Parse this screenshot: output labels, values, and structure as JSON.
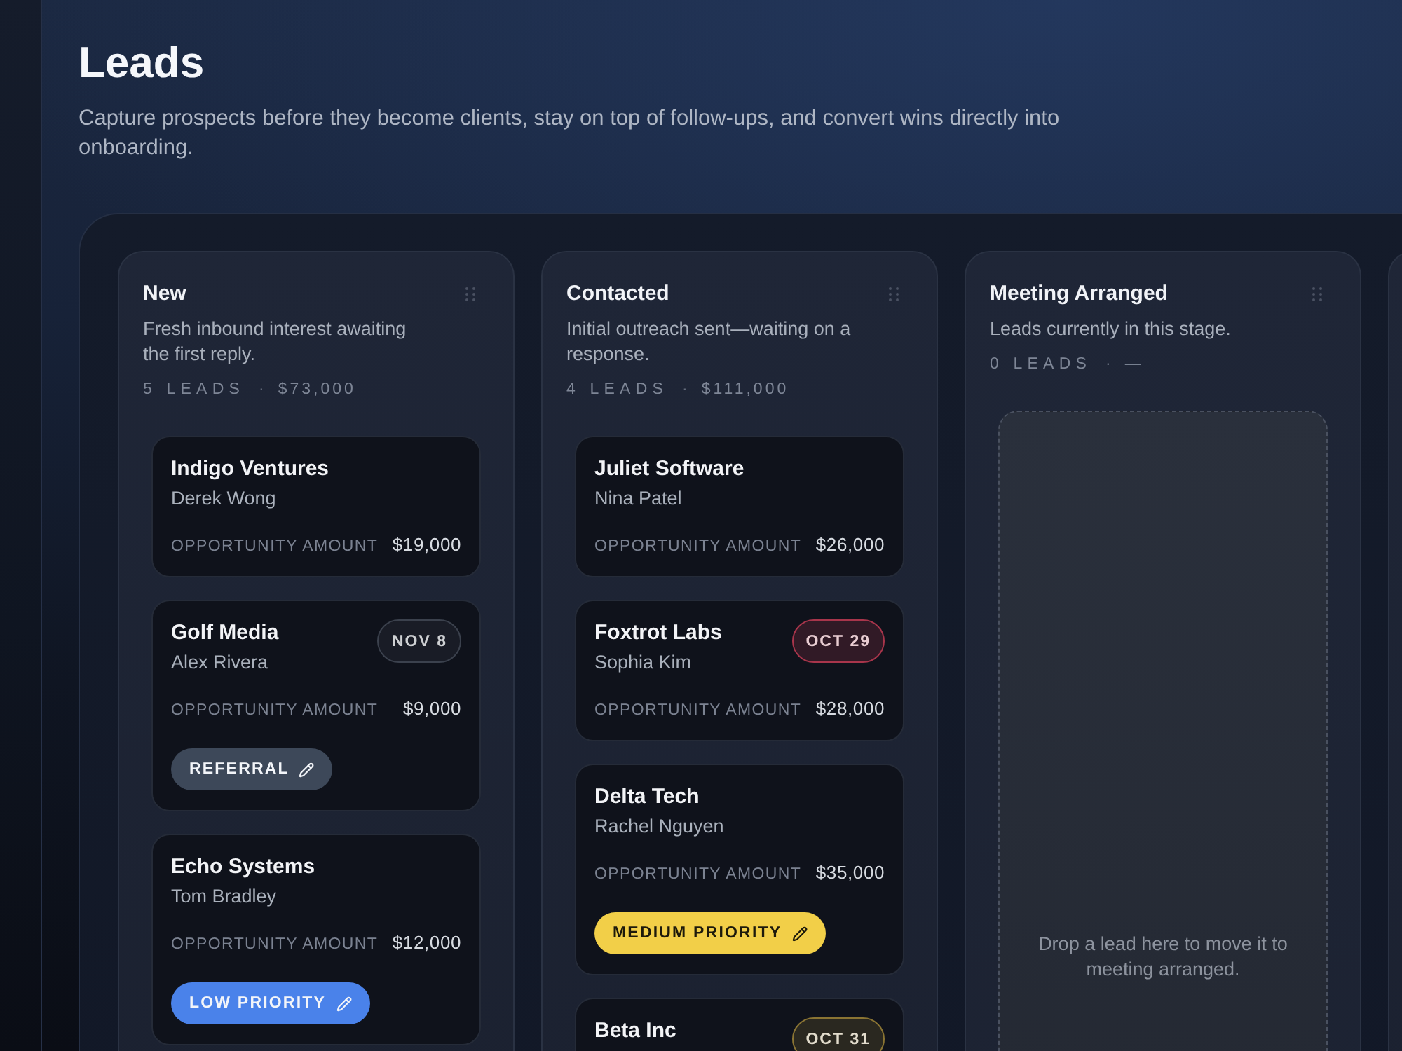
{
  "page": {
    "title": "Leads",
    "subtitle": "Capture prospects before they become clients, stay on top of follow-ups, and convert wins directly into onboarding."
  },
  "stages": [
    {
      "name": "New",
      "description": "Fresh inbound interest awaiting the first reply.",
      "lead_count": "5 LEADS",
      "separator": "·",
      "total": "$73,000",
      "leads": [
        {
          "company": "Indigo Ventures",
          "contact": "Derek Wong",
          "amount_label": "OPPORTUNITY AMOUNT",
          "amount": "$19,000"
        },
        {
          "company": "Golf Media",
          "contact": "Alex Rivera",
          "due": {
            "text": "NOV 8",
            "color": "#3b414d"
          },
          "amount_label": "OPPORTUNITY AMOUNT",
          "amount": "$9,000",
          "tag": {
            "text": "REFERRAL",
            "color": "#3d4859"
          }
        },
        {
          "company": "Echo Systems",
          "contact": "Tom Bradley",
          "amount_label": "OPPORTUNITY AMOUNT",
          "amount": "$12,000",
          "tag": {
            "text": "LOW PRIORITY",
            "color": "#4a82ea"
          }
        }
      ]
    },
    {
      "name": "Contacted",
      "description": "Initial outreach sent—waiting on a response.",
      "lead_count": "4 LEADS",
      "separator": "·",
      "total": "$111,000",
      "leads": [
        {
          "company": "Juliet Software",
          "contact": "Nina Patel",
          "amount_label": "OPPORTUNITY AMOUNT",
          "amount": "$26,000"
        },
        {
          "company": "Foxtrot Labs",
          "contact": "Sophia Kim",
          "due": {
            "text": "OCT 29",
            "color": "#a8354b"
          },
          "amount_label": "OPPORTUNITY AMOUNT",
          "amount": "$28,000"
        },
        {
          "company": "Delta Tech",
          "contact": "Rachel Nguyen",
          "amount_label": "OPPORTUNITY AMOUNT",
          "amount": "$35,000",
          "tag": {
            "text": "MEDIUM PRIORITY",
            "color": "#f2cf48"
          }
        },
        {
          "company": "Beta Inc",
          "due": {
            "text": "OCT 31",
            "color": "#8a7433"
          }
        }
      ]
    },
    {
      "name": "Meeting Arranged",
      "description": "Leads currently in this stage.",
      "lead_count": "0 LEADS",
      "separator": "·",
      "total": "—",
      "empty_message": "Drop a lead here to move it to meeting arranged."
    }
  ]
}
